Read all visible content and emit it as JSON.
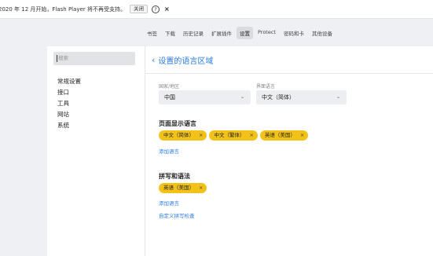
{
  "notice": {
    "text": "2020 年 12 月开始，Flash Player 将不再受支持。",
    "close_label": "关闭",
    "help_label": "?",
    "dismiss_label": "×"
  },
  "topnav": {
    "tabs": [
      "书签",
      "下载",
      "历史记录",
      "扩展插件",
      "设置",
      "Protect",
      "密码和卡",
      "其他设备"
    ],
    "active_index": 4
  },
  "sidebar": {
    "search_placeholder": "搜索",
    "items": [
      "常规设置",
      "接口",
      "工具",
      "网站",
      "系统"
    ]
  },
  "main": {
    "back_icon": "‹",
    "title": "设置的语言区域",
    "country": {
      "label": "国家/地区",
      "value": "中国"
    },
    "ui_language": {
      "label": "界面语言",
      "value": "中文（简体）"
    },
    "display_languages": {
      "title": "页面显示语言",
      "chips": [
        "中文（简体）",
        "中文（繁体）",
        "英语（美国）"
      ],
      "add_link": "添加语言"
    },
    "spelling": {
      "title": "拼写和语法",
      "chips": [
        "英语（美国）"
      ],
      "add_link": "添加语言",
      "custom_link": "自定义拼写检查"
    }
  },
  "colors": {
    "accent": "#2b7bdc",
    "chip": "#f2c21b",
    "background": "#eef0f3"
  }
}
